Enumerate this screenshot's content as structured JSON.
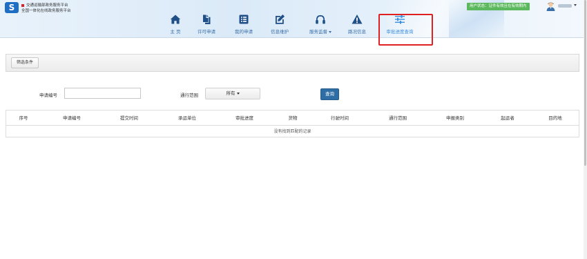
{
  "brand": {
    "title_line1": "交通运输部政务服务平台",
    "title_line2": "全国一体化在线政务服务平台",
    "logo_letter": "S"
  },
  "status_badge": "用户状态：证件有效且在有效期内",
  "nav": {
    "items": [
      {
        "label": "主 页",
        "icon": "home-icon"
      },
      {
        "label": "许可申请",
        "icon": "file-copy-icon"
      },
      {
        "label": "我的申请",
        "icon": "list-icon"
      },
      {
        "label": "信息维护",
        "icon": "edit-icon"
      },
      {
        "label": "服务监督",
        "icon": "headphones-icon",
        "has_dropdown": true
      },
      {
        "label": "路况信息",
        "icon": "warning-icon"
      },
      {
        "label": "审批进度查询",
        "icon": "sliders-icon",
        "active": true
      }
    ]
  },
  "filter": {
    "toggle_label": "筛选条件"
  },
  "form": {
    "app_number_label": "申请编号",
    "app_number_value": "",
    "range_label": "通行范围",
    "range_selected": "所有",
    "query_button": "查询"
  },
  "table": {
    "columns": [
      "序号",
      "申请编号",
      "提交时间",
      "承运单位",
      "审批进度",
      "货物",
      "行驶时间",
      "通行范围",
      "申报类别",
      "起运者",
      "目的地"
    ],
    "empty_message": "没有找到匹配的记录"
  },
  "colors": {
    "nav_text": "#3a6fa8",
    "active_nav": "#3b8fe0",
    "highlight_border": "#e02020",
    "status_badge": "#5cb85c",
    "query_button": "#2f6ea5"
  }
}
